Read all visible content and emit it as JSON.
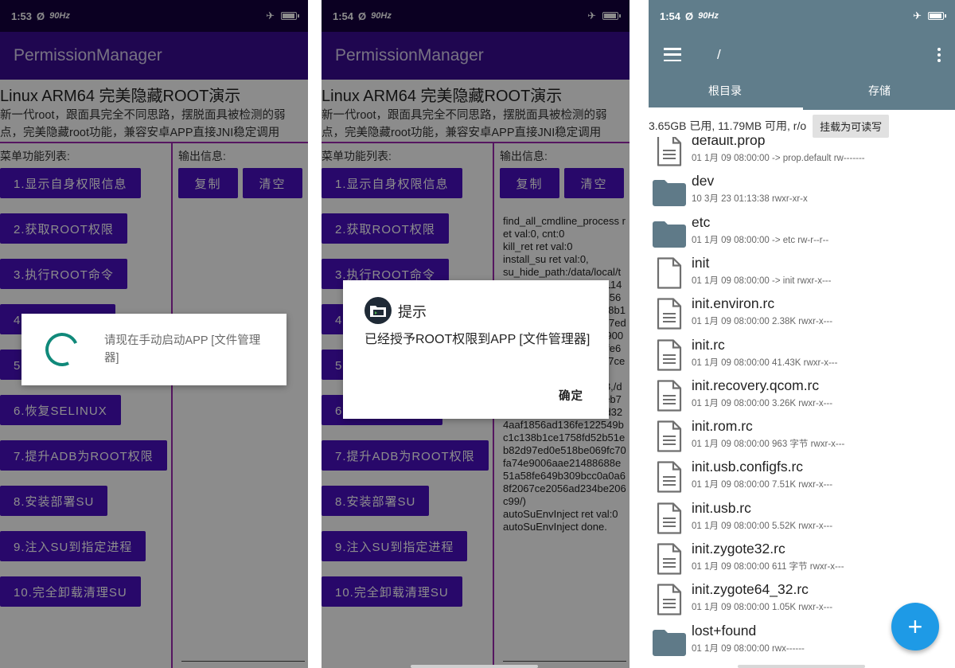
{
  "status_bar": {
    "left": {
      "time": "1:53",
      "hz": "90Hz"
    },
    "middle": {
      "time": "1:54",
      "hz": "90Hz"
    },
    "right": {
      "time": "1:54",
      "hz": "90Hz"
    }
  },
  "permission_manager": {
    "app_title": "PermissionManager",
    "headline": "Linux ARM64 完美隐藏ROOT演示",
    "description": "新一代root，跟面具完全不同思路，摆脱面具被检测的弱点，完美隐藏root功能，兼容安卓APP直接JNI稳定调用",
    "menu_label": "菜单功能列表:",
    "output_label": "输出信息:",
    "copy_label": "复制",
    "clear_label": "清空",
    "menu_items": [
      "1.显示自身权限信息",
      "2.获取ROOT权限",
      "3.执行ROOT命令",
      "4.执行内核命令",
      "5.隐藏ROOT进程",
      "6.恢复SELINUX",
      "7.提升ADB为ROOT权限",
      "8.安装部署SU",
      "9.注入SU到指定进程",
      "10.完全卸载清理SU"
    ],
    "output_text": "find_all_cmdline_process ret val:0, cnt:0\nkill_ret ret val:0\ninstall_su ret val:0,\nsu_hide_path:/data/local/tmp/su_5196eb7197cb114889dd0769ad324aaf1856ad136fe122549bc1c138b1ce1758fd52b51eb82d97ed0e518be069fc70fa74e9006aae21488688e51a58fe649b309bcc0a0a68f2067ce2056ad234be206c99/\nautoSuEnvInject(14788,/data/local/tmp/su_5196eb7197cb114889dd0769ad324aaf1856ad136fe122549bc1c138b1ce1758fd52b51eb82d97ed0e518be069fc70fa74e9006aae21488688e51a58fe649b309bcc0a0a68f2067ce2056ad234be206c99/)\nautoSuEnvInject ret val:0\nautoSuEnvInject done."
  },
  "loading_dialog": {
    "message": "请现在手动启动APP [文件管理器]"
  },
  "alert_dialog": {
    "title": "提示",
    "message": "已经授予ROOT权限到APP [文件管理器]",
    "ok_label": "确定"
  },
  "file_manager": {
    "path": "/",
    "tabs": [
      "根目录",
      "存储"
    ],
    "storage_info": "3.65GB 已用, 11.79MB 可用, r/o",
    "mount_button": "挂载为可读写",
    "fab_label": "+",
    "files": [
      {
        "name": "default.prop",
        "meta": "01 1月 09 08:00:00  -> prop.default  rw-------",
        "type": "file"
      },
      {
        "name": "dev",
        "meta": "10 3月 23 01:13:38   rwxr-xr-x",
        "type": "folder"
      },
      {
        "name": "etc",
        "meta": "01 1月 09 08:00:00  -> etc  rw-r--r--",
        "type": "folder"
      },
      {
        "name": "init",
        "meta": "01 1月 09 08:00:00  -> init  rwxr-x---",
        "type": "file-blank"
      },
      {
        "name": "init.environ.rc",
        "meta": "01 1月 09 08:00:00  2.38K  rwxr-x---",
        "type": "file"
      },
      {
        "name": "init.rc",
        "meta": "01 1月 09 08:00:00  41.43K  rwxr-x---",
        "type": "file"
      },
      {
        "name": "init.recovery.qcom.rc",
        "meta": "01 1月 09 08:00:00  3.26K  rwxr-x---",
        "type": "file"
      },
      {
        "name": "init.rom.rc",
        "meta": "01 1月 09 08:00:00  963 字节  rwxr-x---",
        "type": "file"
      },
      {
        "name": "init.usb.configfs.rc",
        "meta": "01 1月 09 08:00:00  7.51K  rwxr-x---",
        "type": "file"
      },
      {
        "name": "init.usb.rc",
        "meta": "01 1月 09 08:00:00  5.52K  rwxr-x---",
        "type": "file"
      },
      {
        "name": "init.zygote32.rc",
        "meta": "01 1月 09 08:00:00  611 字节  rwxr-x---",
        "type": "file"
      },
      {
        "name": "init.zygote64_32.rc",
        "meta": "01 1月 09 08:00:00  1.05K  rwxr-x---",
        "type": "file"
      },
      {
        "name": "lost+found",
        "meta": "01 1月 09 08:00:00   rwx------",
        "type": "folder"
      }
    ]
  },
  "colors": {
    "status_purple": "#14003f",
    "appbar_purple": "#3a0b92",
    "button_purple": "#4a0fc2",
    "divider_magenta": "#9c29b0",
    "spinner_teal": "#10897a",
    "fm_bluegrey": "#607d8b",
    "fab_blue": "#1e9ae6"
  }
}
